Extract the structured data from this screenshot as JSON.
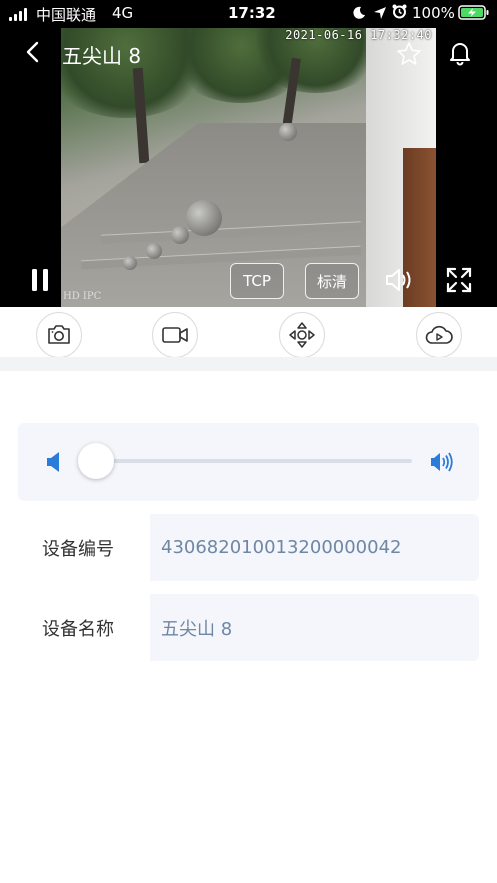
{
  "status_bar": {
    "carrier": "中国联通",
    "network": "4G",
    "time": "17:32",
    "battery": "100%"
  },
  "header": {
    "title": "五尖山 8"
  },
  "video": {
    "timestamp": "2021-06-16 17:32:40",
    "watermark": "HD IPC",
    "protocol_label": "TCP",
    "quality_label": "标清"
  },
  "volume": {
    "level": 0
  },
  "device_info": [
    {
      "label": "设备编号",
      "value": "430682010013200000042"
    },
    {
      "label": "设备名称",
      "value": "五尖山 8"
    }
  ],
  "colors": {
    "accent": "#2b7bd9",
    "value_text": "#6e87a5",
    "card_bg": "#f4f6fb"
  }
}
